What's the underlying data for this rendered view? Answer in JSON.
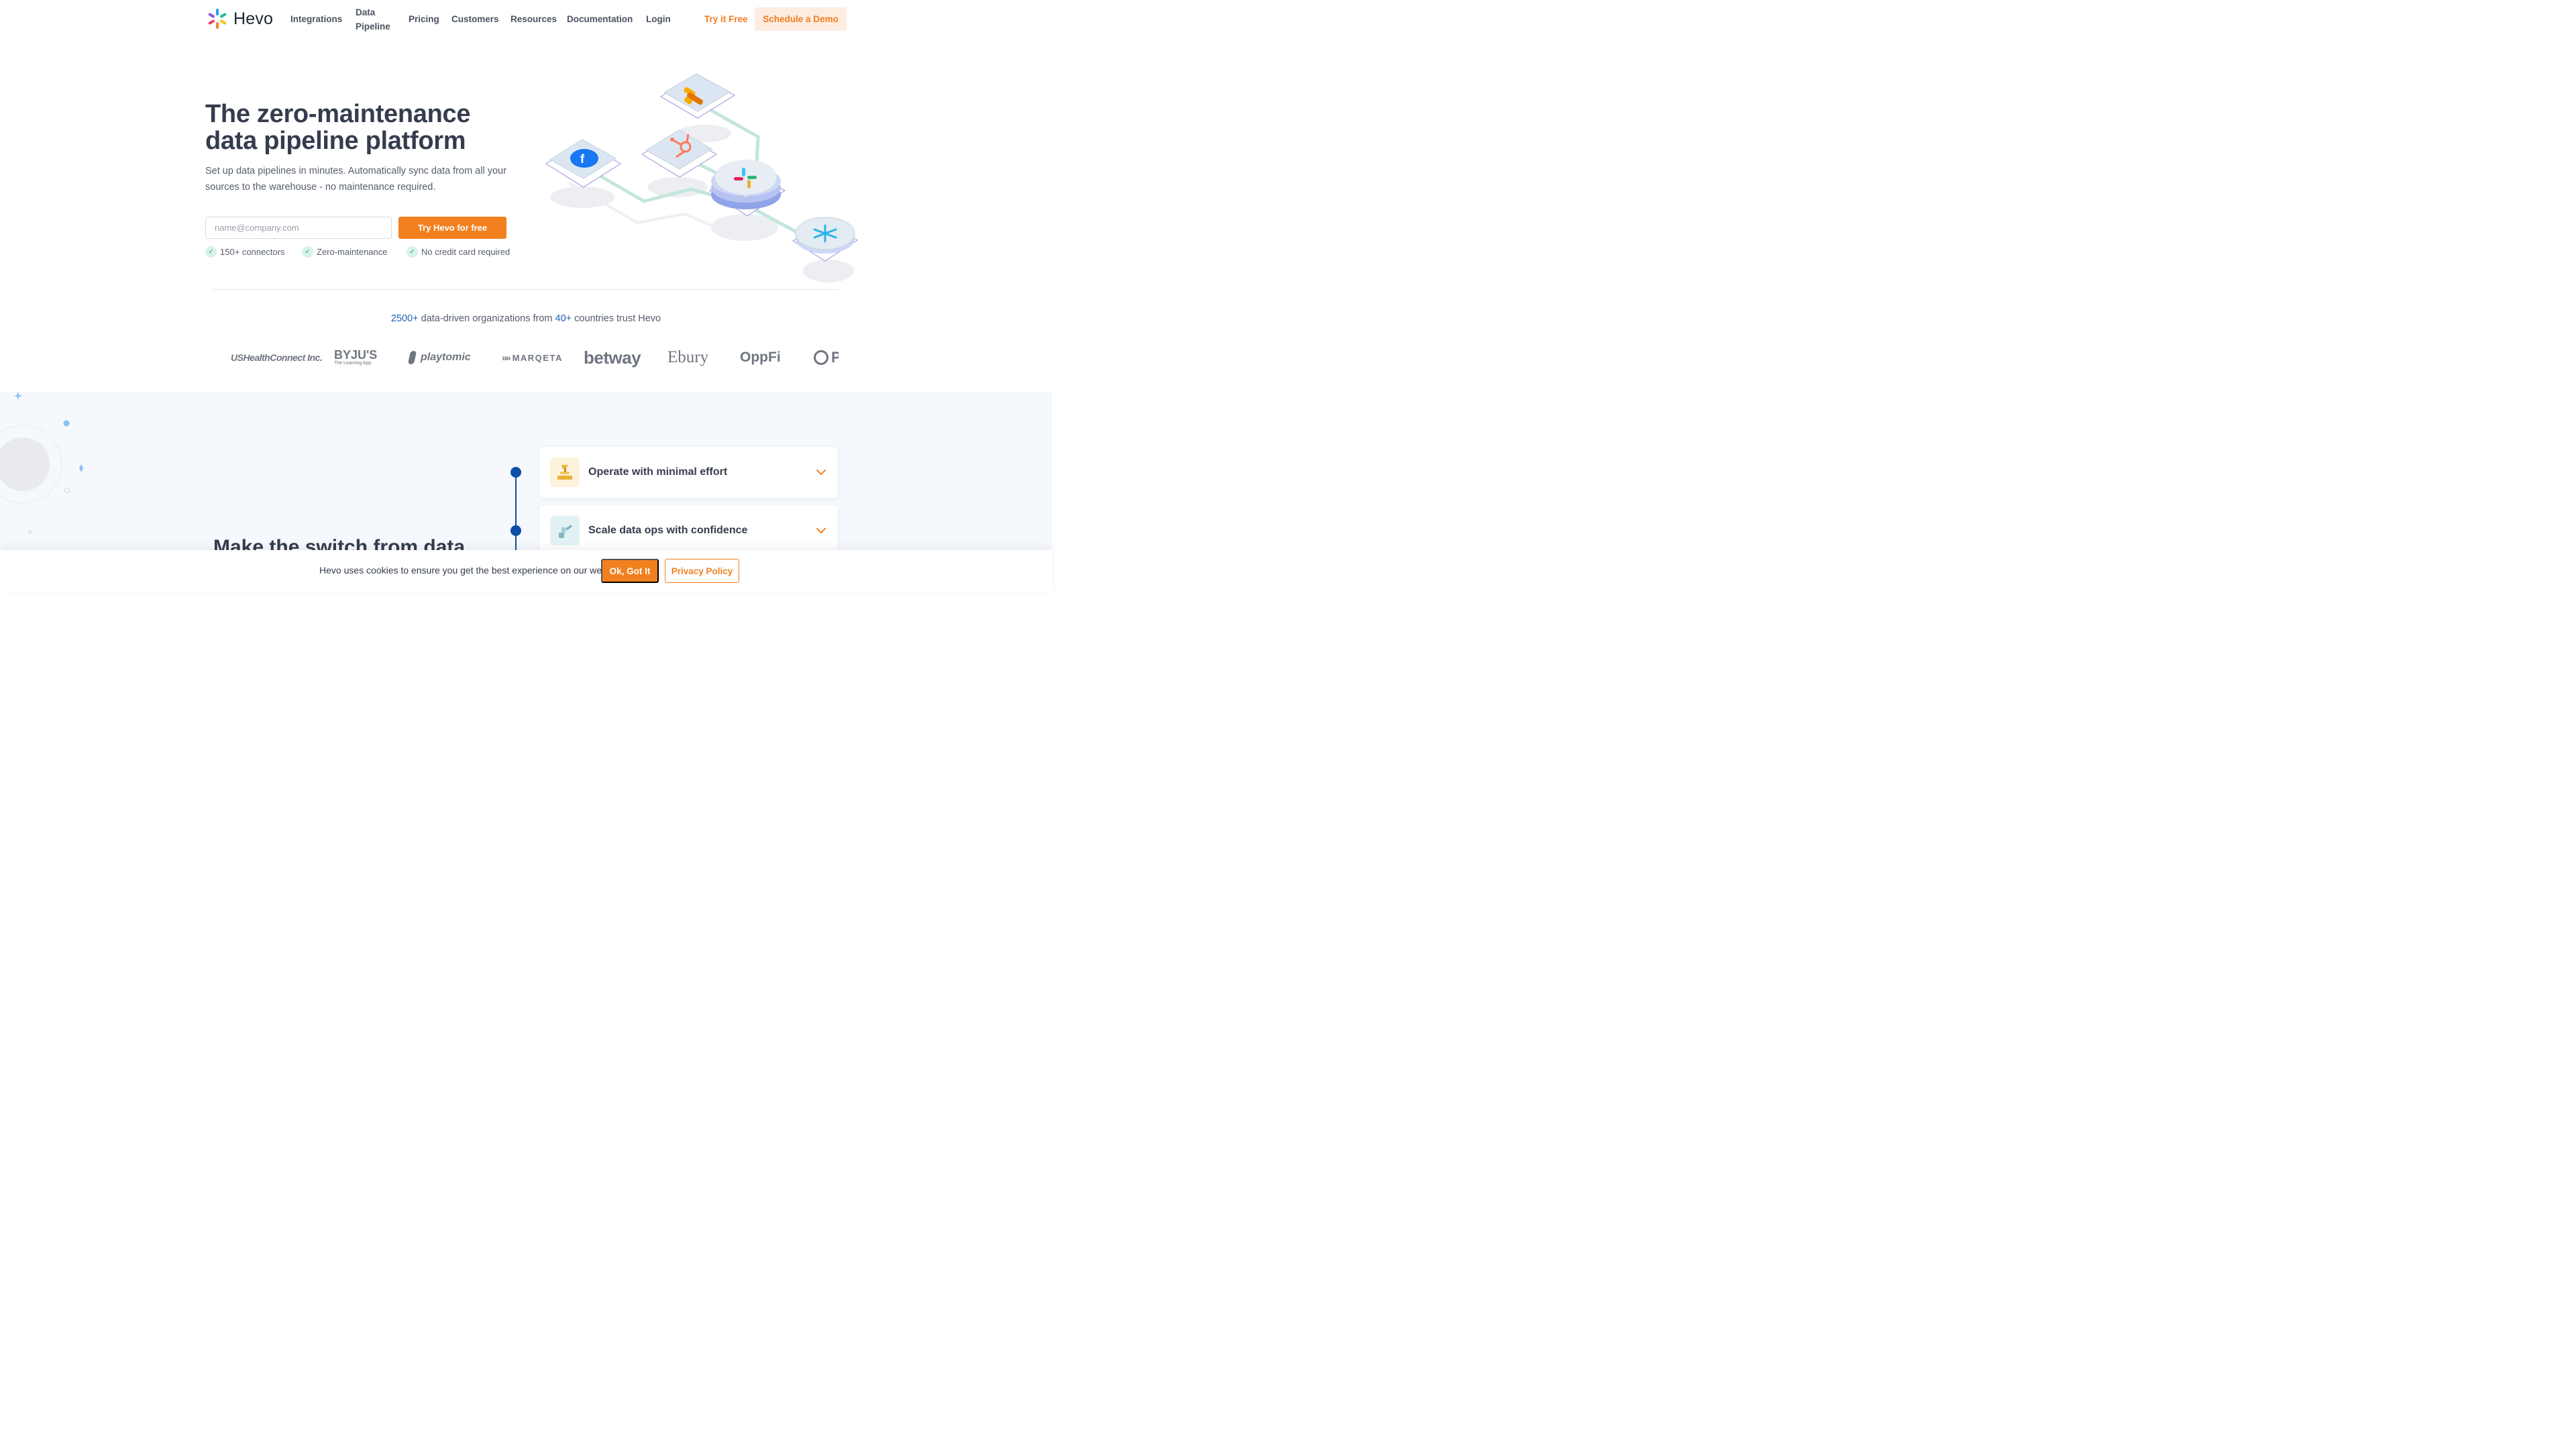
{
  "nav": {
    "brand": "Hevo",
    "links": [
      "Integrations",
      "Data Pipeline",
      "Pricing",
      "Customers",
      "Resources",
      "Documentation",
      "Login"
    ],
    "link_data_pipeline_line1": "Data",
    "link_data_pipeline_line2": "Pipeline",
    "try_free": "Try it Free",
    "schedule_demo": "Schedule a Demo"
  },
  "hero": {
    "title_line1": "The zero-maintenance",
    "title_line2": "data pipeline platform",
    "subtitle": "Set up data pipelines in minutes. Automatically sync data from all your sources to the warehouse - no maintenance required.",
    "email_placeholder": "name@company.com",
    "cta": "Try Hevo for free",
    "checks": [
      "150+ connectors",
      "Zero-maintenance",
      "No credit card required"
    ]
  },
  "trust": {
    "count": "2500+",
    "mid": " data-driven organizations from ",
    "countries": "40+",
    "end": " countries trust Hevo"
  },
  "customers": [
    "USHealthConnect Inc.",
    "BYJU'S",
    "playtomic",
    "MARQETA",
    "betway",
    "Ebury",
    "OppFi",
    "P"
  ],
  "customer_sublabels": {
    "byjus": "The Learning App"
  },
  "section2": {
    "title": "Make the switch from data",
    "cards": [
      {
        "title": "Operate with minimal effort"
      },
      {
        "title": "Scale data ops with confidence"
      }
    ]
  },
  "cookie": {
    "text": "Hevo uses cookies to ensure you get the best experience on our website.",
    "ok": "Ok, Got It",
    "privacy": "Privacy Policy"
  },
  "colors": {
    "accent": "#f2801f",
    "accent_soft": "#fdece0",
    "navy": "#0d4ea6",
    "link_blue": "#1e62b8",
    "heading": "#353c4d"
  },
  "icons": {
    "logo": "hevo-pinwheel-icon",
    "check": "check-icon",
    "chevron": "chevron-down-icon",
    "sources": [
      "google-analytics-icon",
      "facebook-icon",
      "hubspot-icon",
      "slack-icon",
      "snowflake-icon"
    ]
  }
}
